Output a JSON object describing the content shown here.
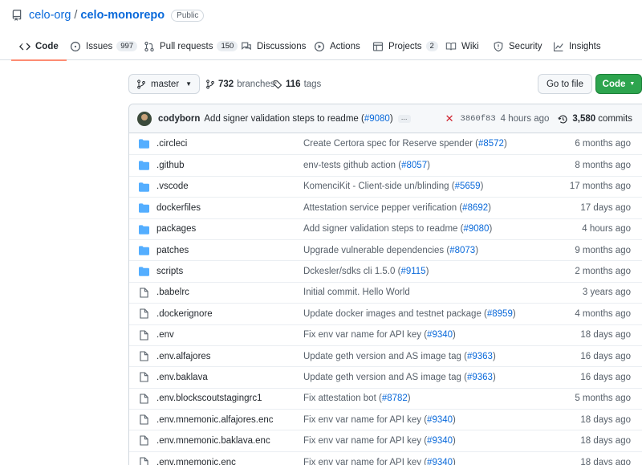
{
  "repo": {
    "owner": "celo-org",
    "name": "celo-monorepo",
    "visibility": "Public"
  },
  "tabs": [
    {
      "label": "Code",
      "count": null,
      "icon": "code-icon",
      "active": true
    },
    {
      "label": "Issues",
      "count": "997",
      "icon": "issue-icon"
    },
    {
      "label": "Pull requests",
      "count": "150",
      "icon": "pull-request-icon"
    },
    {
      "label": "Discussions",
      "count": null,
      "icon": "discussion-icon"
    },
    {
      "label": "Actions",
      "count": null,
      "icon": "play-icon"
    },
    {
      "label": "Projects",
      "count": "2",
      "icon": "table-icon"
    },
    {
      "label": "Wiki",
      "count": null,
      "icon": "book-icon"
    },
    {
      "label": "Security",
      "count": null,
      "icon": "shield-icon"
    },
    {
      "label": "Insights",
      "count": null,
      "icon": "graph-icon"
    }
  ],
  "toolbar": {
    "branch": "master",
    "branches_count": "732",
    "branches_label": "branches",
    "tags_count": "116",
    "tags_label": "tags",
    "go_to_file": "Go to file",
    "code_button": "Code"
  },
  "latest_commit": {
    "author": "codyborn",
    "message": "Add signer validation steps to readme (",
    "pr": "#9080",
    "message_end": ")",
    "status": "failed",
    "sha": "3860f83",
    "time": "4 hours ago",
    "commits_count": "3,580",
    "commits_label": "commits"
  },
  "files": [
    {
      "type": "dir",
      "name": ".circleci",
      "msg": "Create Certora spec for Reserve spender",
      "pr": "#8572",
      "age": "6 months ago"
    },
    {
      "type": "dir",
      "name": ".github",
      "msg": "env-tests github action",
      "pr": "#8057",
      "age": "8 months ago"
    },
    {
      "type": "dir",
      "name": ".vscode",
      "msg": "KomenciKit - Client-side un/blinding",
      "pr": "#5659",
      "age": "17 months ago"
    },
    {
      "type": "dir",
      "name": "dockerfiles",
      "msg": "Attestation service pepper verification",
      "pr": "#8692",
      "age": "17 days ago"
    },
    {
      "type": "dir",
      "name": "packages",
      "msg": "Add signer validation steps to readme",
      "pr": "#9080",
      "age": "4 hours ago"
    },
    {
      "type": "dir",
      "name": "patches",
      "msg": "Upgrade vulnerable dependencies",
      "pr": "#8073",
      "age": "9 months ago"
    },
    {
      "type": "dir",
      "name": "scripts",
      "msg": "Dckesler/sdks cli 1.5.0",
      "pr": "#9115",
      "age": "2 months ago"
    },
    {
      "type": "file",
      "name": ".babelrc",
      "msg": "Initial commit. Hello World",
      "pr": "",
      "age": "3 years ago"
    },
    {
      "type": "file",
      "name": ".dockerignore",
      "msg": "Update docker images and testnet package",
      "pr": "#8959",
      "age": "4 months ago"
    },
    {
      "type": "file",
      "name": ".env",
      "msg": "Fix env var name for API key",
      "pr": "#9340",
      "age": "18 days ago"
    },
    {
      "type": "file",
      "name": ".env.alfajores",
      "msg": "Update geth version and AS image tag",
      "pr": "#9363",
      "age": "16 days ago"
    },
    {
      "type": "file",
      "name": ".env.baklava",
      "msg": "Update geth version and AS image tag",
      "pr": "#9363",
      "age": "16 days ago"
    },
    {
      "type": "file",
      "name": ".env.blockscoutstagingrc1",
      "msg": "Fix attestation bot",
      "pr": "#8782",
      "age": "5 months ago"
    },
    {
      "type": "file",
      "name": ".env.mnemonic.alfajores.enc",
      "msg": "Fix env var name for API key",
      "pr": "#9340",
      "age": "18 days ago"
    },
    {
      "type": "file",
      "name": ".env.mnemonic.baklava.enc",
      "msg": "Fix env var name for API key",
      "pr": "#9340",
      "age": "18 days ago"
    },
    {
      "type": "file",
      "name": ".env.mnemonic.enc",
      "msg": "Fix env var name for API key",
      "pr": "#9340",
      "age": "18 days ago"
    }
  ],
  "colors": {
    "link": "#0969da",
    "folder": "#54aeff",
    "primary_button": "#2da44e",
    "active_tab_underline": "#fd8c73",
    "fail": "#cf222e"
  }
}
